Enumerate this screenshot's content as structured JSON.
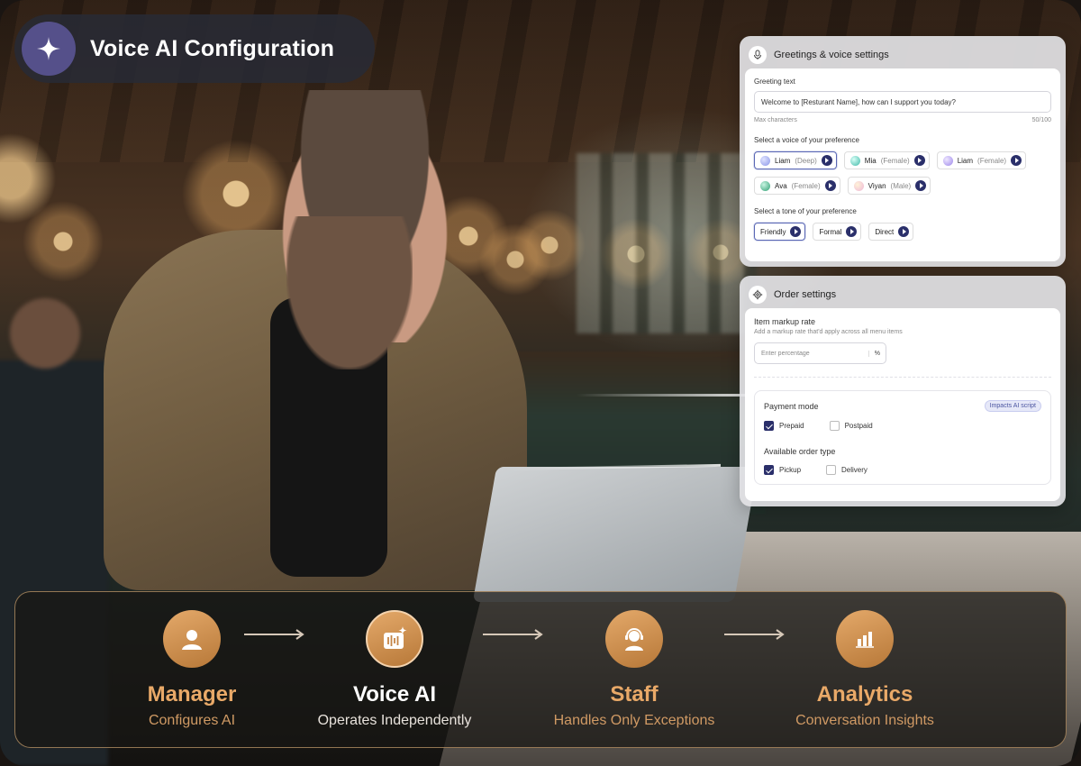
{
  "header": {
    "title": "Voice AI Configuration",
    "icon": "sparkle-icon"
  },
  "greetings": {
    "title": "Greetings & voice settings",
    "greeting_label": "Greeting text",
    "greeting_value": "Welcome to [Resturant Name], how can I support you today?",
    "max_label": "Max characters",
    "count": "50/100",
    "voice_label": "Select a voice of your preference",
    "voices": [
      {
        "name": "Liam",
        "sub": "(Deep)",
        "selected": true,
        "color": "#9aa6ee"
      },
      {
        "name": "Mia",
        "sub": "(Female)",
        "selected": false,
        "color": "#6fd0c4"
      },
      {
        "name": "Liam",
        "sub": "(Female)",
        "selected": false,
        "color": "#b7a4f0"
      },
      {
        "name": "Ava",
        "sub": "(Female)",
        "selected": false,
        "color": "#45b88a"
      },
      {
        "name": "Viyan",
        "sub": "(Male)",
        "selected": false,
        "color": "#f2c6df"
      }
    ],
    "tone_label": "Select a tone of your preference",
    "tones": [
      {
        "name": "Friendly",
        "selected": true
      },
      {
        "name": "Formal",
        "selected": false
      },
      {
        "name": "Direct",
        "selected": false
      }
    ]
  },
  "order": {
    "title": "Order settings",
    "markup_label": "Item markup rate",
    "markup_help": "Add a markup rate that'd apply across all menu items",
    "markup_placeholder": "Enter percentage",
    "markup_unit": "%",
    "payment_label": "Payment mode",
    "payment_badge": "Impacts AI script",
    "payment_options": [
      {
        "name": "Prepaid",
        "checked": true
      },
      {
        "name": "Postpaid",
        "checked": false
      }
    ],
    "order_type_label": "Available order type",
    "order_types": [
      {
        "name": "Pickup",
        "checked": true
      },
      {
        "name": "Delivery",
        "checked": false
      }
    ]
  },
  "flow": {
    "steps": [
      {
        "title": "Manager",
        "desc": "Configures AI",
        "icon": "user-icon"
      },
      {
        "title": "Voice AI",
        "desc": "Operates Independently",
        "icon": "voice-ai-icon"
      },
      {
        "title": "Staff",
        "desc": "Handles Only Exceptions",
        "icon": "headset-agent-icon"
      },
      {
        "title": "Analytics",
        "desc": "Conversation Insights",
        "icon": "bar-chart-icon"
      }
    ]
  }
}
